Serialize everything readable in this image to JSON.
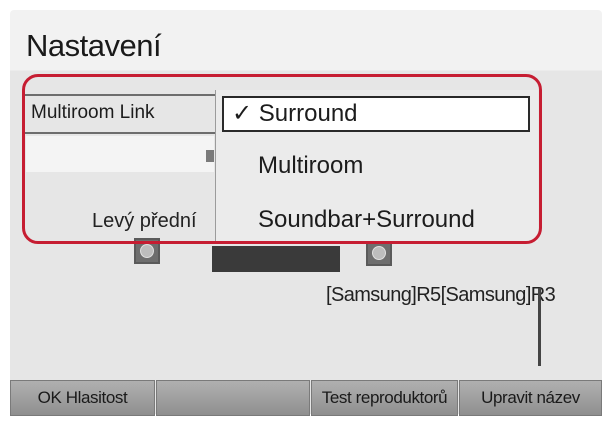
{
  "screen": {
    "title": "Nastavení",
    "setting_label": "Multiroom Link",
    "dropdown": {
      "check_mark": "✓",
      "options": [
        "Surround",
        "Multiroom",
        "Soundbar+Surround"
      ],
      "selected": "Surround"
    },
    "speakers": {
      "left_label": "Levý přední",
      "right_labels": "[Samsung]R5[Samsung]R3"
    },
    "highlight_color": "#c61d32"
  },
  "buttons": {
    "ok_volume": "OK Hlasitost",
    "test_speakers": "Test reproduktorů",
    "rename": "Upravit název"
  }
}
